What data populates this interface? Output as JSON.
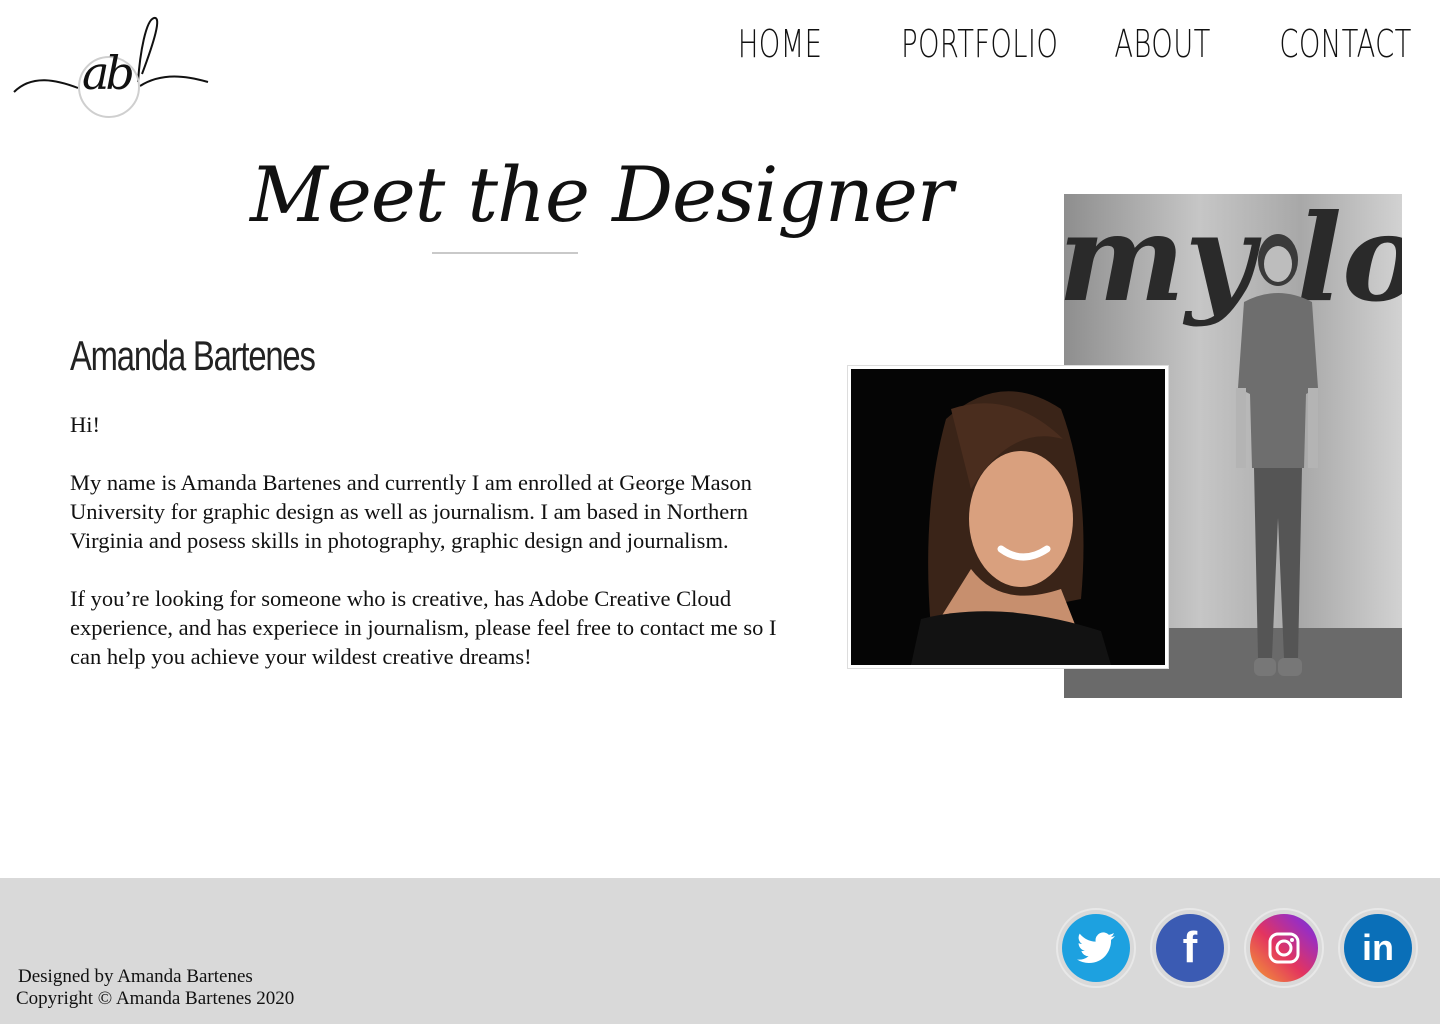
{
  "logo": {
    "monogram": "ab"
  },
  "nav": {
    "items": [
      "HOME",
      "PORTFOLIO",
      "ABOUT",
      "CONTACT"
    ]
  },
  "heading": "Meet the Designer",
  "profile": {
    "name": "Amanda Bartenes",
    "greeting": "Hi!",
    "paragraph1": "My name is Amanda Bartenes and currently I am enrolled at George Mason University for graphic design as well as journalism. I am based in Northern Virginia and posess skills in photography, graphic design and journalism.",
    "paragraph2": "If you’re looking for someone who is creative, has Adobe Creative Cloud experience, and has experiece in journalism, please feel free to contact me so I can help you achieve your wildest creative dreams!"
  },
  "photos": {
    "wall_script": "my love"
  },
  "footer": {
    "designed_by": "Designed by Amanda Bartenes",
    "copyright": "Copyright © Amanda Bartenes 2020",
    "social": [
      {
        "icon": "twitter-icon",
        "color": "#1da1e0"
      },
      {
        "icon": "facebook-icon",
        "color": "#3b5bb3",
        "glyph": "f"
      },
      {
        "icon": "instagram-icon",
        "color": "#e3345f"
      },
      {
        "icon": "linkedin-icon",
        "color": "#0a6fb8",
        "glyph": "in"
      }
    ]
  }
}
